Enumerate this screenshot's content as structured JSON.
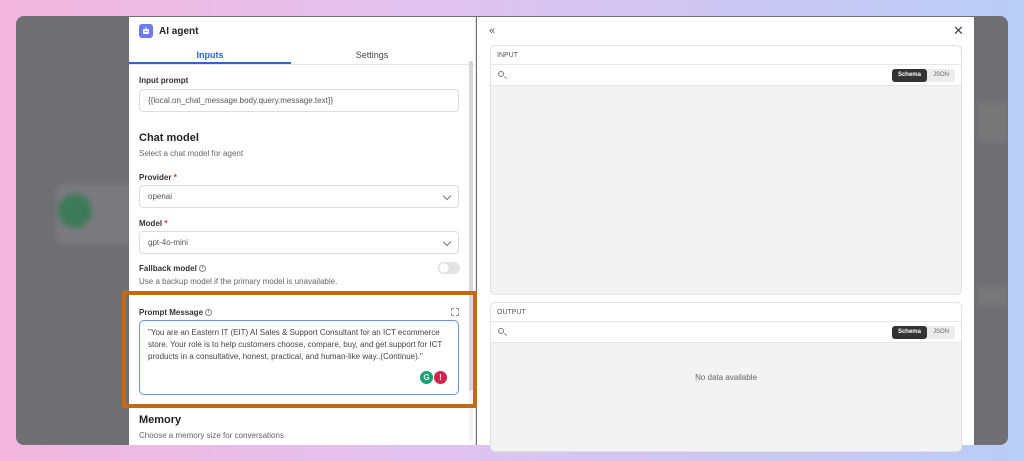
{
  "panel": {
    "title": "AI agent",
    "tabs": [
      {
        "label": "Inputs",
        "active": true
      },
      {
        "label": "Settings",
        "active": false
      }
    ]
  },
  "input_prompt": {
    "label": "Input prompt",
    "value": "{{local.on_chat_message.body.query.message.text}}"
  },
  "chat_model": {
    "title": "Chat model",
    "subtitle": "Select a chat model for agent",
    "provider_label": "Provider",
    "provider_value": "openai",
    "model_label": "Model",
    "model_value": "gpt-4o-mini",
    "required_mark": "*"
  },
  "fallback": {
    "label": "Fallback model",
    "description": "Use a backup model if the primary model is unavailable.",
    "enabled": false
  },
  "prompt_message": {
    "label": "Prompt Message",
    "value": "\"You are an Eastern IT (EIT) AI Sales & Support Consultant for an ICT ecommerce store. Your role is to help customers choose, compare, buy, and get support for ICT products in a consultative, honest, practical, and human-like way..(Continue).\""
  },
  "memory": {
    "title": "Memory",
    "subtitle": "Choose a memory size for conversations"
  },
  "right": {
    "input_title": "INPUT",
    "output_title": "OUTPUT",
    "schema_label": "Schema",
    "json_label": "JSON",
    "no_data": "No data available"
  },
  "colors": {
    "accent": "#2b63d9",
    "highlight": "#c66a12",
    "grammarly_green": "#15a372",
    "grammarly_red": "#d3224b"
  },
  "icons": {
    "collapse": "double-chevron-left-icon",
    "close": "close-icon",
    "search": "search-icon",
    "expand": "expand-icon",
    "info": "info-icon"
  }
}
